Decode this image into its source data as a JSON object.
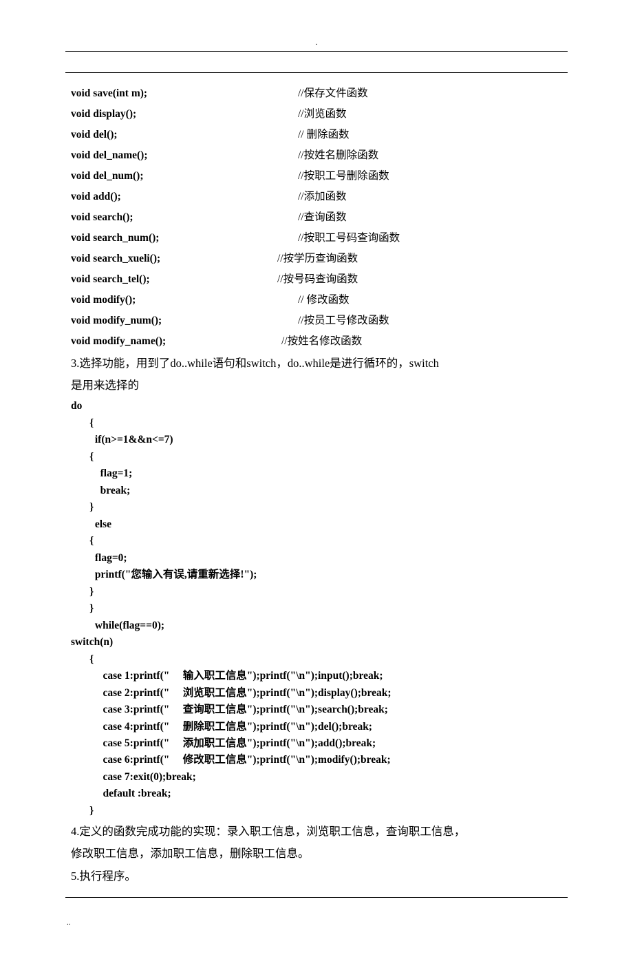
{
  "header_symbol": ".",
  "decls": [
    {
      "sig": "  void save(int m);",
      "cmt": "//保存文件函数"
    },
    {
      "sig": "  void display();",
      "cmt": "//浏览函数"
    },
    {
      "sig": "  void del();",
      "cmt": "//  删除函数"
    },
    {
      "sig": "  void del_name();",
      "cmt": " //按姓名删除函数"
    },
    {
      "sig": "  void del_num();",
      "cmt": " //按职工号删除函数"
    },
    {
      "sig": "  void add();",
      "cmt": " //添加函数"
    },
    {
      "sig": "  void search();",
      "cmt": "//查询函数"
    },
    {
      "sig": "  void search_num();",
      "cmt": " //按职工号码查询函数"
    },
    {
      "sig": "  void search_xueli();",
      "cmt": "//按学历查询函数",
      "w": "300"
    },
    {
      "sig": "  void search_tel();",
      "cmt": "//按号码查询函数",
      "w": "300"
    },
    {
      "sig": "  void modify();",
      "cmt": "//  修改函数"
    },
    {
      "sig": "  void modify_num();",
      "cmt": " //按员工号修改函数"
    },
    {
      "sig": "  void modify_name();",
      "cmt": "//按姓名修改函数",
      "w": "306"
    }
  ],
  "para3a": "3.选择功能，用到了do..while语句和switch，do..while是进行循环的，switch",
  "para3b": "是用来选择的",
  "code_block1": [
    "do",
    "       {",
    "         if(n>=1&&n<=7)",
    "       {",
    "           flag=1;",
    "           break;",
    "       }",
    "         else",
    "       {",
    "         flag=0;",
    "         printf(\"您输入有误,请重新选择!\");",
    "       }",
    "       }",
    "         while(flag==0);"
  ],
  "code_block2": [
    "switch(n)",
    "       {",
    "            case 1:printf(\"     输入职工信息\");printf(\"\\n\");input();break;",
    "            case 2:printf(\"     浏览职工信息\");printf(\"\\n\");display();break;",
    "            case 3:printf(\"     查询职工信息\");printf(\"\\n\");search();break;",
    "            case 4:printf(\"     删除职工信息\");printf(\"\\n\");del();break;",
    "            case 5:printf(\"     添加职工信息\");printf(\"\\n\");add();break;",
    "            case 6:printf(\"     修改职工信息\");printf(\"\\n\");modify();break;",
    "            case 7:exit(0);break;",
    "            default :break;",
    "       }"
  ],
  "para4a": "4.定义的函数完成功能的实现：录入职工信息，浏览职工信息，查询职工信息，",
  "para4b": "修改职工信息，添加职工信息，删除职工信息。",
  "para5": "5.执行程序。",
  "footer_symbol": ".."
}
